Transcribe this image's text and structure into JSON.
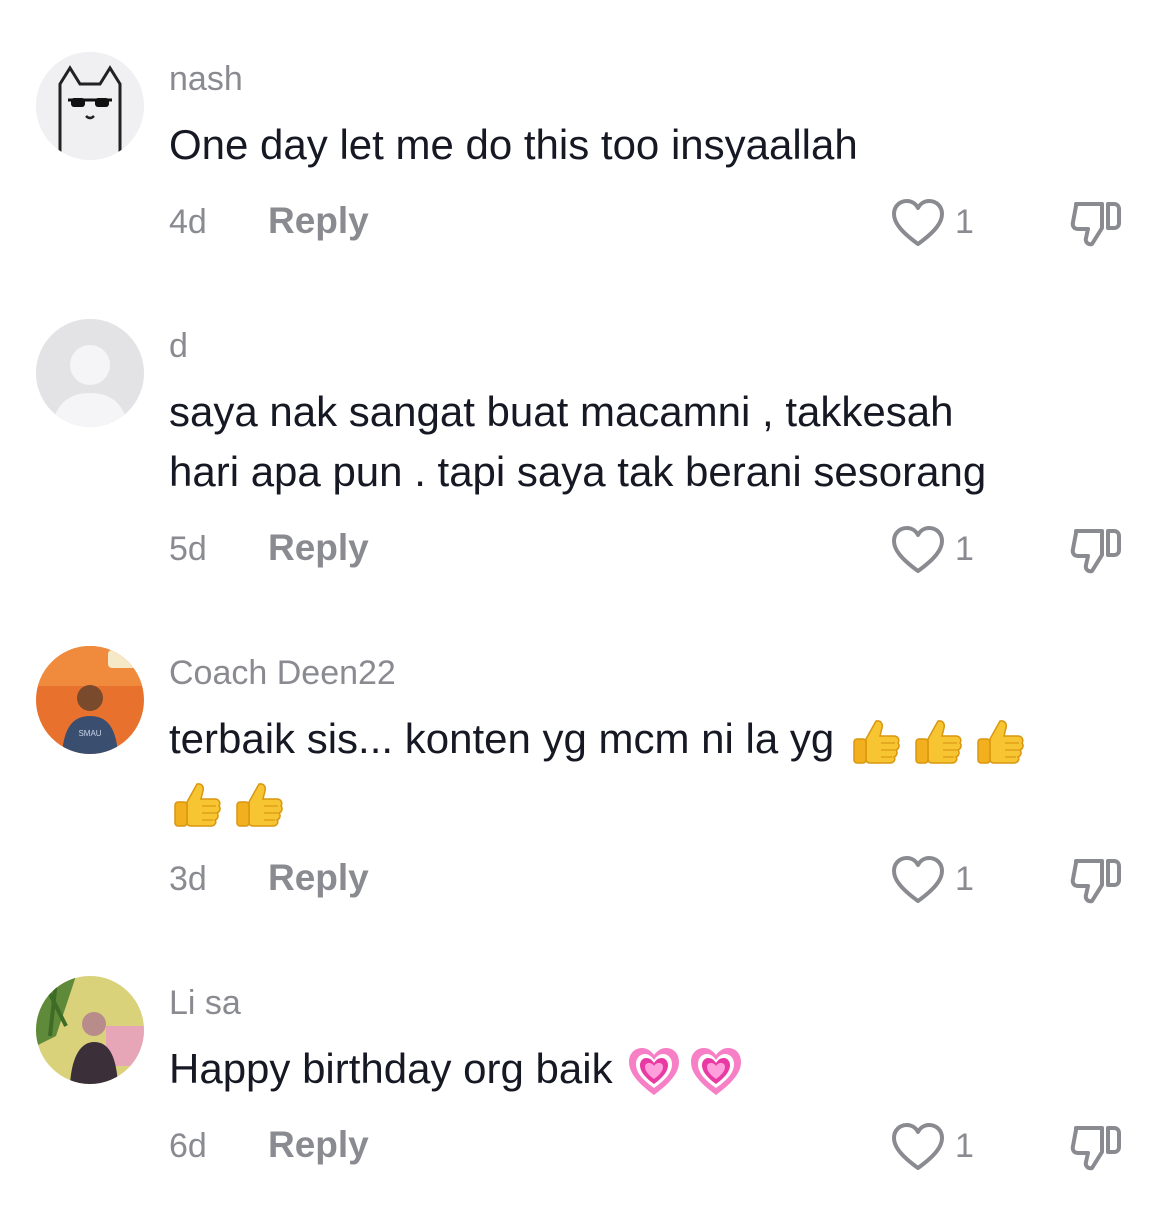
{
  "comments": [
    {
      "username": "nash",
      "lines": [
        "One day let me do this too insyaallah"
      ],
      "age": "4d",
      "reply_label": "Reply",
      "likes": "1",
      "avatar": "cat-sunglasses-avatar"
    },
    {
      "username": "d",
      "lines": [
        "saya nak sangat buat macamni , takkesah",
        "hari apa pun . tapi saya tak berani sesorang"
      ],
      "age": "5d",
      "reply_label": "Reply",
      "likes": "1",
      "avatar": "default-avatar"
    },
    {
      "username": "Coach Deen22",
      "lines": [
        "terbaik sis... konten yg mcm ni la yg"
      ],
      "emoji": "thumbs-up x5",
      "age": "3d",
      "reply_label": "Reply",
      "likes": "1",
      "avatar": "man-photo-avatar"
    },
    {
      "username": "Li sa",
      "lines": [
        "Happy birthday org baik"
      ],
      "emoji": "growing-heart x2",
      "age": "6d",
      "reply_label": "Reply",
      "likes": "1",
      "avatar": "woman-photo-avatar"
    }
  ],
  "colors": {
    "text": "#161823",
    "secondary": "#8a8b91",
    "background": "#ffffff"
  },
  "icons": {
    "like": "heart-outline-icon",
    "dislike": "thumbs-down-outline-icon"
  }
}
